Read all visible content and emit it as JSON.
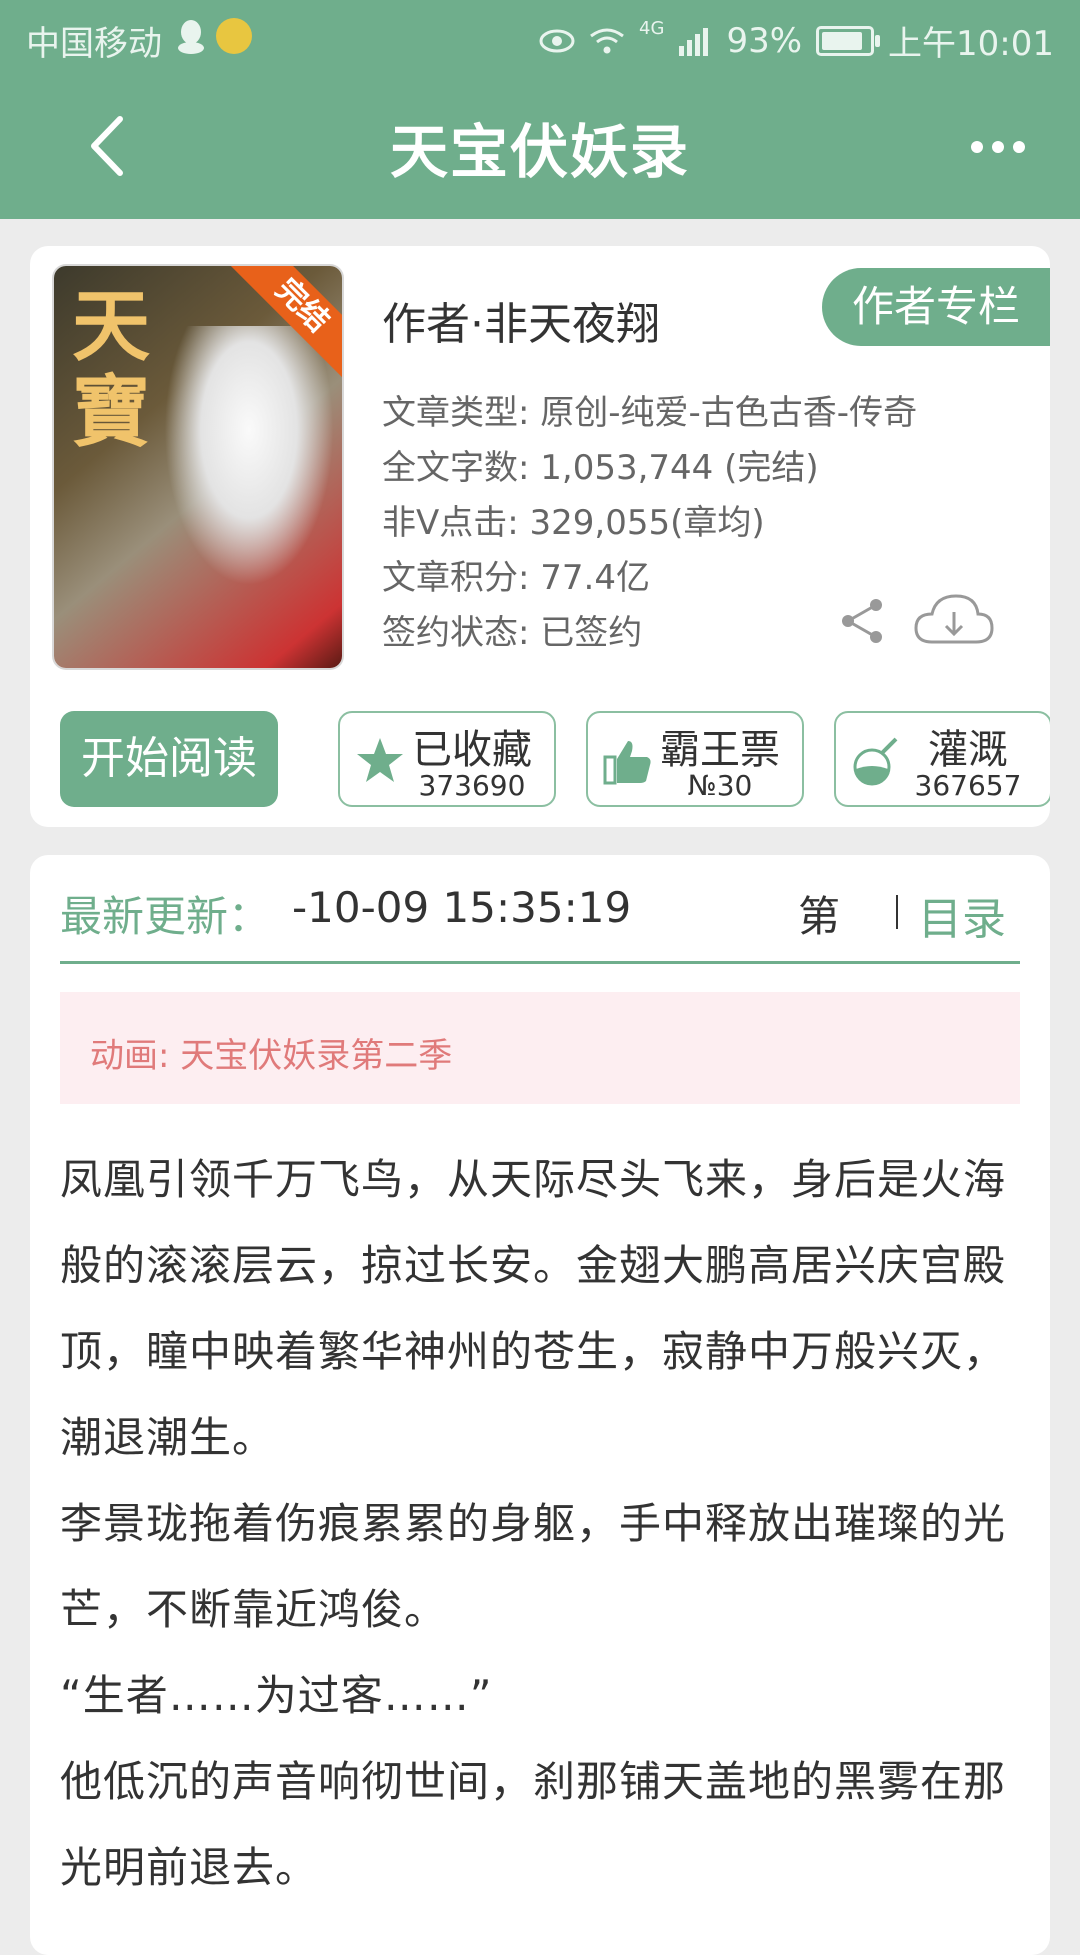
{
  "status_bar": {
    "carrier": "中国移动",
    "network": "4G",
    "battery": "93%",
    "time": "上午10:01"
  },
  "header": {
    "title": "天宝伏妖录"
  },
  "book": {
    "cover_title": "天寶",
    "cover_badge": "完结",
    "author": "作者·非天夜翔",
    "author_column_label": "作者专栏",
    "meta": [
      "文章类型: 原创-纯爱-古色古香-传奇",
      "全文字数: 1,053,744 (完结)",
      "非Ⅴ点击: 329,055(章均)",
      "文章积分: 77.4亿",
      "签约状态: 已签约"
    ],
    "read_label": "开始阅读",
    "actions": [
      {
        "label": "已收藏",
        "value": "373690",
        "icon": "star-icon"
      },
      {
        "label": "霸王票",
        "value": "№30",
        "icon": "thumbs-up-icon"
      },
      {
        "label": "灌溉",
        "value": "367657",
        "icon": "nutrient-flask-icon"
      }
    ]
  },
  "update": {
    "label": "最新更新：",
    "time": "-10-09 15:35:19",
    "chapter_hint": "第",
    "toc_label": "目录"
  },
  "notice": "动画: 天宝伏妖录第二季",
  "synopsis": [
    "凤凰引领千万飞鸟，从天际尽头飞来，身后是火海般的滚滚层云，掠过长安。金翅大鹏高居兴庆宫殿顶，瞳中映着繁华神州的苍生，寂静中万般兴灭，潮退潮生。",
    "李景珑拖着伤痕累累的身躯，手中释放出璀璨的光芒，不断靠近鸿俊。",
    "“生者……为过客……”",
    "他低沉的声音响彻世间，刹那铺天盖地的黑雾在那光明前退去。"
  ],
  "colors": {
    "brand": "#6fae8c",
    "notice_bg": "#fdeef1",
    "notice_text": "#e07a7a"
  }
}
